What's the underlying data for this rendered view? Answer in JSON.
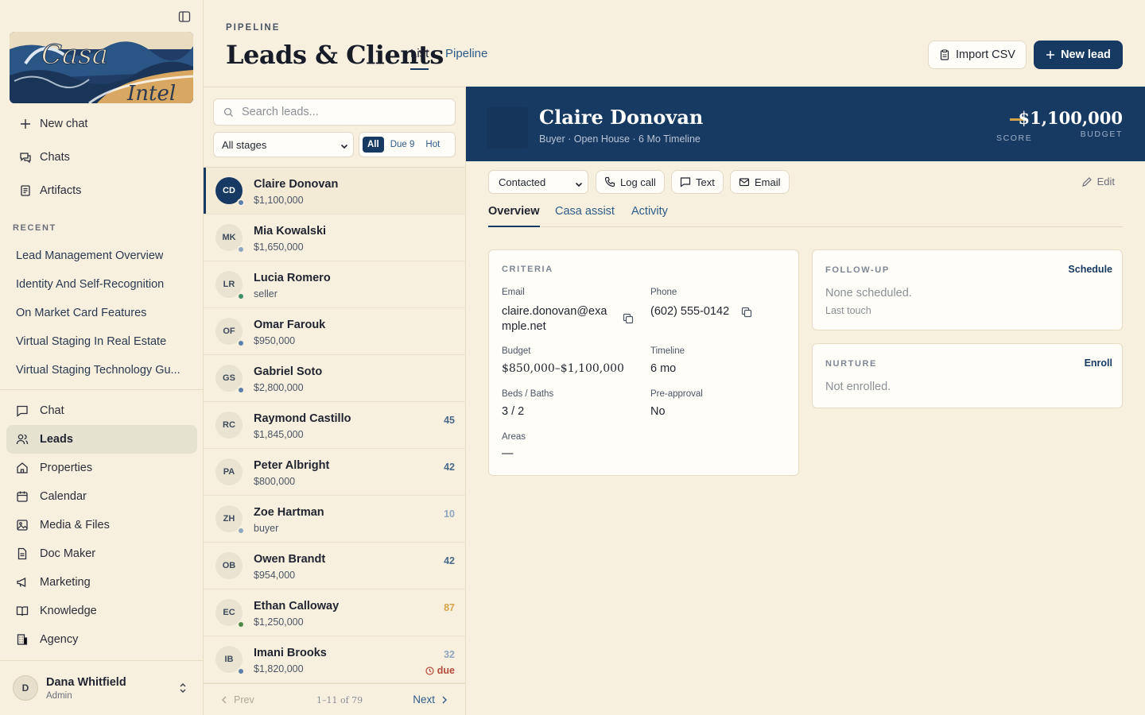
{
  "sidebar": {
    "logo_text": "Casa Intel",
    "top_nav": [
      {
        "label": "New chat",
        "icon": "plus-icon"
      },
      {
        "label": "Chats",
        "icon": "chats-icon"
      },
      {
        "label": "Artifacts",
        "icon": "artifacts-icon"
      }
    ],
    "recent_label": "RECENT",
    "recent": [
      "Lead Management Overview",
      "Identity And Self-Recognition",
      "On Market Card Features",
      "Virtual Staging In Real Estate",
      "Virtual Staging Technology Gu..."
    ],
    "main_nav": [
      {
        "label": "Chat",
        "icon": "chat-icon"
      },
      {
        "label": "Leads",
        "icon": "users-icon",
        "active": true
      },
      {
        "label": "Properties",
        "icon": "home-icon"
      },
      {
        "label": "Calendar",
        "icon": "calendar-icon"
      },
      {
        "label": "Media & Files",
        "icon": "image-icon"
      },
      {
        "label": "Doc Maker",
        "icon": "document-icon"
      },
      {
        "label": "Marketing",
        "icon": "megaphone-icon"
      },
      {
        "label": "Knowledge",
        "icon": "book-icon"
      },
      {
        "label": "Agency",
        "icon": "building-icon"
      }
    ],
    "user": {
      "initial": "D",
      "name": "Dana Whitfield",
      "role": "Admin"
    }
  },
  "header": {
    "eyebrow": "PIPELINE",
    "title": "Leads & Clients",
    "tabs": [
      {
        "label": "List",
        "active": true
      },
      {
        "label": "Pipeline",
        "active": false
      }
    ],
    "import_label": "Import CSV",
    "new_lead_label": "New lead"
  },
  "list": {
    "search_placeholder": "Search leads...",
    "stage_filter": "All stages",
    "chips": [
      {
        "label": "All",
        "active": true
      },
      {
        "label": "Due 9"
      },
      {
        "label": "Hot"
      }
    ],
    "leads": [
      {
        "initials": "CD",
        "name": "Claire Donovan",
        "sub": "$1,100,000",
        "score": "",
        "due": "",
        "dot": "#5b7fa8",
        "selected": true
      },
      {
        "initials": "MK",
        "name": "Mia Kowalski",
        "sub": "$1,650,000",
        "score": "",
        "due": "",
        "dot": "#8fa6c0"
      },
      {
        "initials": "LR",
        "name": "Lucia Romero",
        "sub": "seller",
        "score": "",
        "due": "",
        "dot": "#3f8f6a"
      },
      {
        "initials": "OF",
        "name": "Omar Farouk",
        "sub": "$950,000",
        "score": "",
        "due": "",
        "dot": "#5b7fa8"
      },
      {
        "initials": "GS",
        "name": "Gabriel Soto",
        "sub": "$2,800,000",
        "score": "",
        "due": "",
        "dot": "#5b7fa8"
      },
      {
        "initials": "RC",
        "name": "Raymond Castillo",
        "sub": "$1,845,000",
        "score": "45",
        "score_color": "#4a6a8c",
        "due": "",
        "dot": ""
      },
      {
        "initials": "PA",
        "name": "Peter Albright",
        "sub": "$800,000",
        "score": "42",
        "score_color": "#4a6a8c",
        "due": "",
        "dot": ""
      },
      {
        "initials": "ZH",
        "name": "Zoe Hartman",
        "sub": "buyer",
        "score": "10",
        "score_color": "#8fa6c0",
        "due": "",
        "dot": "#8fa6c0"
      },
      {
        "initials": "OB",
        "name": "Owen Brandt",
        "sub": "$954,000",
        "score": "42",
        "score_color": "#4a6a8c",
        "due": "",
        "dot": ""
      },
      {
        "initials": "EC",
        "name": "Ethan Calloway",
        "sub": "$1,250,000",
        "score": "87",
        "score_color": "#d8a24a",
        "due": "",
        "dot": "#4f8a4a"
      },
      {
        "initials": "IB",
        "name": "Imani Brooks",
        "sub": "$1,820,000",
        "score": "32",
        "score_color": "#8fa6c0",
        "due": "due",
        "dot": "#5b7fa8"
      }
    ],
    "pager": {
      "prev": "Prev",
      "count": "1–11 of 79",
      "next": "Next"
    }
  },
  "detail": {
    "name": "Claire Donovan",
    "meta": "Buyer · Open House · 6 Mo Timeline",
    "score_label": "SCORE",
    "budget": "$1,100,000",
    "budget_label": "BUDGET",
    "status": "Contacted",
    "actions": {
      "log_call": "Log call",
      "text": "Text",
      "email": "Email",
      "edit": "Edit"
    },
    "tabs": [
      {
        "label": "Overview",
        "active": true
      },
      {
        "label": "Casa assist"
      },
      {
        "label": "Activity"
      }
    ],
    "criteria": {
      "label": "CRITERIA",
      "email_label": "Email",
      "email_line1": "claire.donovan@exa",
      "email_line2": "mple.net",
      "phone_label": "Phone",
      "phone": "(602) 555-0142",
      "budget_label": "Budget",
      "budget": "$850,000–$1,100,000",
      "timeline_label": "Timeline",
      "timeline": "6 mo",
      "beds_label": "Beds / Baths",
      "beds": "3 / 2",
      "preapproval_label": "Pre-approval",
      "preapproval": "No",
      "areas_label": "Areas",
      "areas": "—"
    },
    "followup": {
      "label": "FOLLOW-UP",
      "action": "Schedule",
      "status": "None scheduled.",
      "sub": "Last touch"
    },
    "nurture": {
      "label": "NURTURE",
      "action": "Enroll",
      "status": "Not enrolled."
    }
  },
  "colors": {
    "navy": "#173a63",
    "cream": "#f7f0de",
    "gold": "#d8a24a",
    "link": "#2e5c8a",
    "due": "#b54a3a"
  }
}
